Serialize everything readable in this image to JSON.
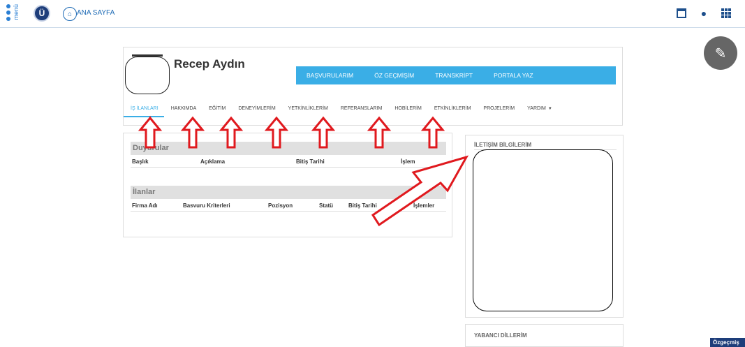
{
  "topbar": {
    "menu_label": "menü",
    "logo_text": "Ü",
    "home_label": "ANA SAYFA",
    "icons": [
      "calendar-icon",
      "globe-icon",
      "apps-grid-icon"
    ]
  },
  "profile": {
    "name": "Recep Aydın",
    "actions": [
      "BAŞVURULARIM",
      "ÖZ GEÇMİŞİM",
      "TRANSKRİPT",
      "PORTALA YAZ"
    ],
    "tabs": [
      "İŞ İLANLARI",
      "HAKKIMDA",
      "EĞİTİM",
      "DENEYİMLERİM",
      "YETKİNLİKLERİM",
      "REFERANSLARIM",
      "HOBİLERİM",
      "ETKİNLİKLERİM",
      "PROJELERİM",
      "YARDIM"
    ],
    "active_tab": "İŞ İLANLARI"
  },
  "announcements": {
    "title": "Duyurular",
    "columns": [
      "Başlık",
      "Açıklama",
      "Bitiş Tarihi",
      "İşlem"
    ]
  },
  "listings": {
    "title": "İlanlar",
    "columns": [
      "Firma Adı",
      "Basvuru Kriterleri",
      "Pozisyon",
      "Statü",
      "Bitiş Tarihi",
      "İşlemler"
    ]
  },
  "contact": {
    "title": "İLETİŞİM BİLGİLERİM"
  },
  "languages": {
    "title": "YABANCI DİLLERİM"
  },
  "badge_label": "Özgeçmiş",
  "colors": {
    "accent": "#3aaee6",
    "navy": "#1d3d7a",
    "annotation": "#e0191e"
  }
}
